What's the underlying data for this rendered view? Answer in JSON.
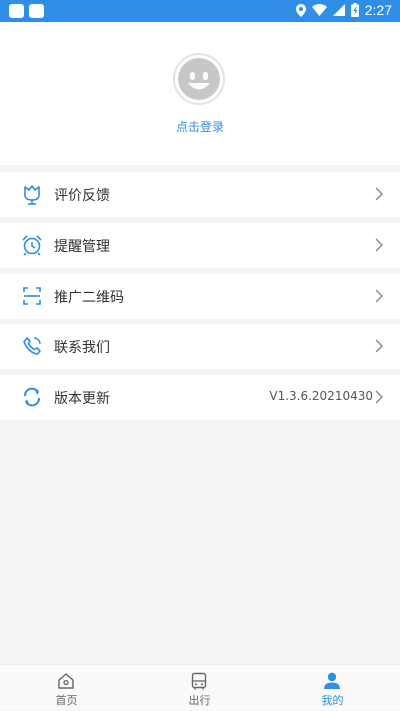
{
  "status_bar": {
    "time": "2:27"
  },
  "profile": {
    "login_text": "点击登录"
  },
  "menu": [
    {
      "label": "评价反馈",
      "icon": "tulip-icon"
    },
    {
      "label": "提醒管理",
      "icon": "alarm-clock-icon"
    },
    {
      "label": "推广二维码",
      "icon": "scan-icon"
    },
    {
      "label": "联系我们",
      "icon": "phone-icon"
    },
    {
      "label": "版本更新",
      "icon": "refresh-icon",
      "value": "V1.3.6.20210430"
    }
  ],
  "tabs": [
    {
      "label": "首页",
      "icon": "home-icon",
      "active": false
    },
    {
      "label": "出行",
      "icon": "bus-icon",
      "active": false
    },
    {
      "label": "我的",
      "icon": "user-icon",
      "active": true
    }
  ],
  "colors": {
    "accent": "#2f8ee6",
    "status_bar": "#2f8ee6",
    "background": "#f5f5f5"
  }
}
